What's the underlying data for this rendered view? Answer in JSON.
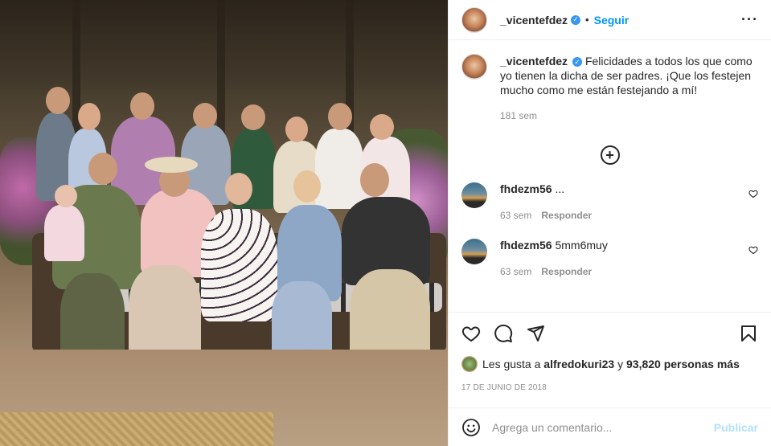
{
  "post": {
    "username": "_vicentefdez",
    "follow_label": "Seguir",
    "dot": "•",
    "caption": "Felicidades a todos los que como yo tienen la dicha de ser padres. ¡Que los festejen mucho como me están festejando a mí!",
    "caption_age": "181 sem",
    "date": "17 de junio de 2018",
    "photo_description": "family-group-photo"
  },
  "comments": [
    {
      "user": "fhdezm56",
      "text": "...",
      "age": "63 sem",
      "reply_label": "Responder"
    },
    {
      "user": "fhdezm56",
      "text": "5mm6muy",
      "age": "63 sem",
      "reply_label": "Responder"
    }
  ],
  "likes": {
    "prefix": "Les gusta a",
    "user": "alfredokuri23",
    "connector": "y",
    "count": "93,820 personas más"
  },
  "add_comment": {
    "placeholder": "Agrega un comentario...",
    "publish_label": "Publicar"
  },
  "icons": {
    "verified": "verified-badge-icon",
    "more": "more-options-icon",
    "load_more": "plus-circle-icon",
    "like": "heart-icon",
    "comment": "comment-bubble-icon",
    "share": "paper-plane-icon",
    "save": "bookmark-icon",
    "emoji": "emoji-icon"
  },
  "colors": {
    "accent": "#0095f6",
    "publish_disabled": "#b2dffc",
    "muted": "#8e8e8e"
  }
}
